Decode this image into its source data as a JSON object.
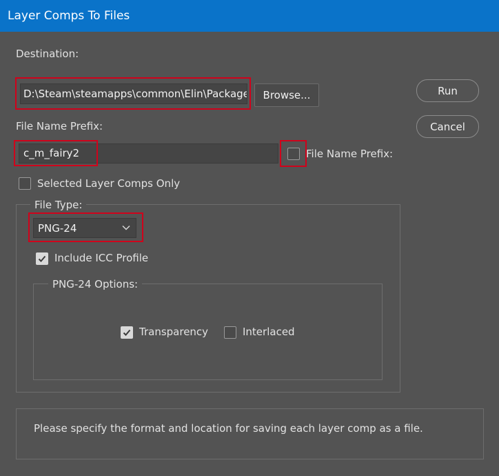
{
  "window": {
    "title": "Layer Comps To Files"
  },
  "destination": {
    "label": "Destination:",
    "value": "D:\\Steam\\steamapps\\common\\Elin\\Package\\Mod",
    "browse_label": "Browse..."
  },
  "actions": {
    "run_label": "Run",
    "cancel_label": "Cancel"
  },
  "prefix": {
    "label": "File Name Prefix:",
    "value": "c_m_fairy2",
    "checkbox_label": "File Name Prefix:",
    "checkbox_checked": false
  },
  "selected_only": {
    "label": "Selected Layer Comps Only",
    "checked": false
  },
  "file_type": {
    "legend": "File Type:",
    "selected": "PNG-24",
    "include_icc": {
      "label": "Include ICC Profile",
      "checked": true
    },
    "options": {
      "legend": "PNG-24 Options:",
      "transparency": {
        "label": "Transparency",
        "checked": true
      },
      "interlaced": {
        "label": "Interlaced",
        "checked": false
      }
    }
  },
  "info": {
    "text": "Please specify the format and location for saving each layer comp as a file."
  },
  "colors": {
    "titlebar": "#0a73c9",
    "background": "#535353",
    "highlight": "#d0021b"
  }
}
